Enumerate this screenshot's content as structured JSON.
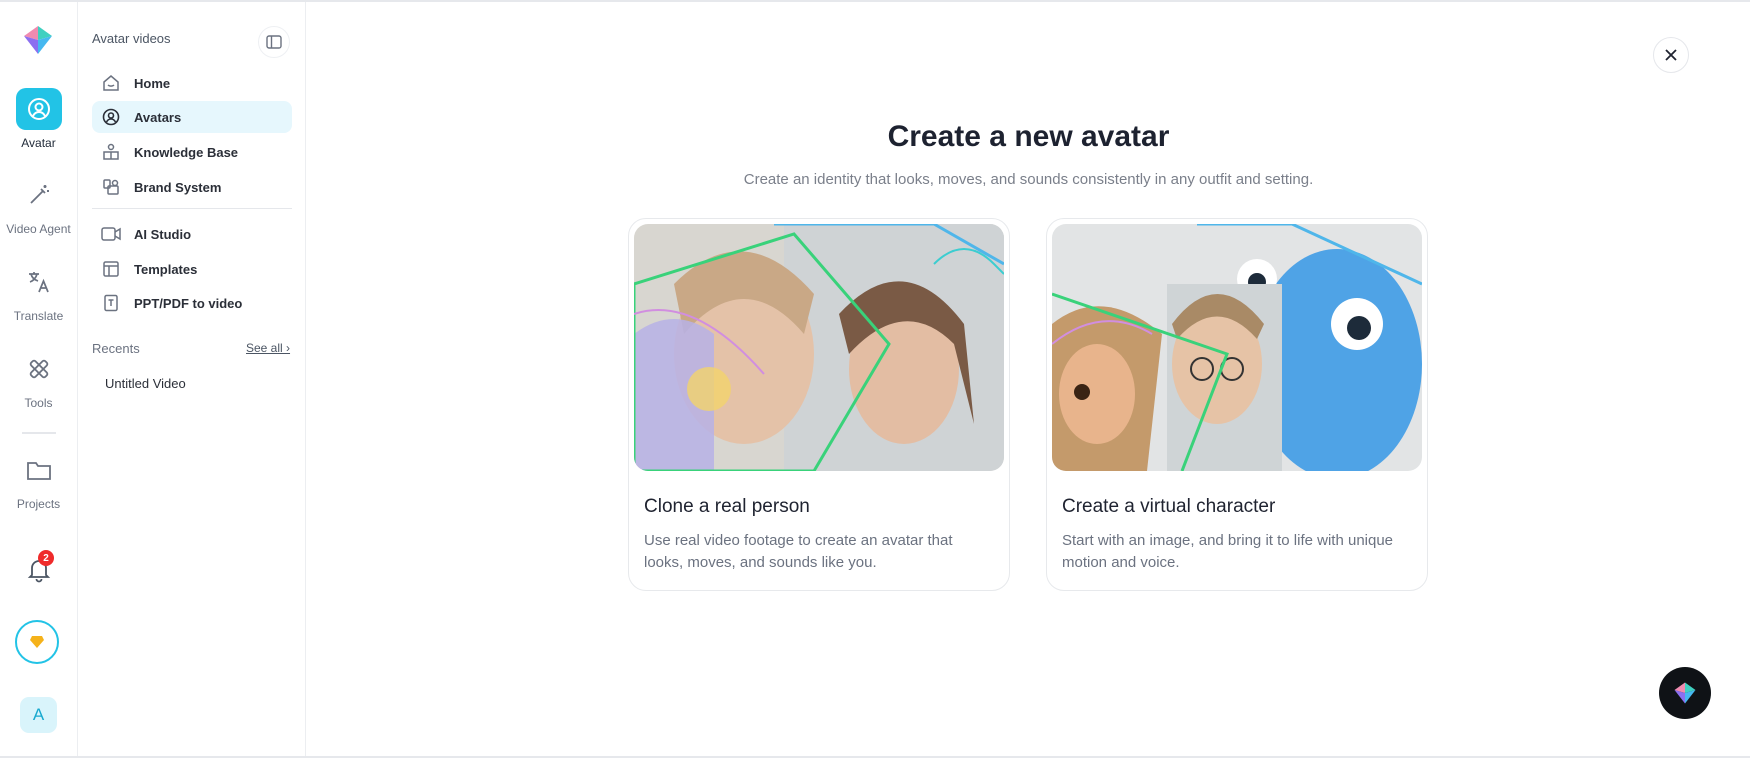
{
  "rail": {
    "items": [
      {
        "label": "Avatar",
        "icon": "avatar-icon"
      },
      {
        "label": "Video Agent",
        "icon": "magic-wand-icon"
      },
      {
        "label": "Translate",
        "icon": "translate-icon"
      },
      {
        "label": "Tools",
        "icon": "tools-icon"
      },
      {
        "label": "Projects",
        "icon": "folder-icon"
      }
    ],
    "notifications_count": "2",
    "user_initial": "A"
  },
  "sidebar": {
    "title": "Avatar videos",
    "items": [
      {
        "label": "Home",
        "icon": "home-icon"
      },
      {
        "label": "Avatars",
        "icon": "avatar-circle-icon"
      },
      {
        "label": "Knowledge Base",
        "icon": "knowledge-base-icon"
      },
      {
        "label": "Brand System",
        "icon": "brand-system-icon"
      },
      {
        "label": "AI Studio",
        "icon": "video-camera-icon"
      },
      {
        "label": "Templates",
        "icon": "templates-icon"
      },
      {
        "label": "PPT/PDF to video",
        "icon": "document-icon"
      }
    ],
    "recents_label": "Recents",
    "see_all": "See all ›",
    "recent_items": [
      "Untitled Video"
    ]
  },
  "main": {
    "title": "Create a new avatar",
    "subtitle": "Create an identity that looks, moves, and sounds consistently in any outfit and setting.",
    "cards": [
      {
        "title": "Clone a real person",
        "description": "Use real video footage to create an avatar that looks, moves, and sounds like you."
      },
      {
        "title": "Create a virtual character",
        "description": "Start with an image, and bring it to life with unique motion and voice."
      }
    ]
  },
  "colors": {
    "accent": "#22c3e6",
    "active_nav_bg": "#e6f7fd",
    "badge": "#ef2b2b"
  }
}
